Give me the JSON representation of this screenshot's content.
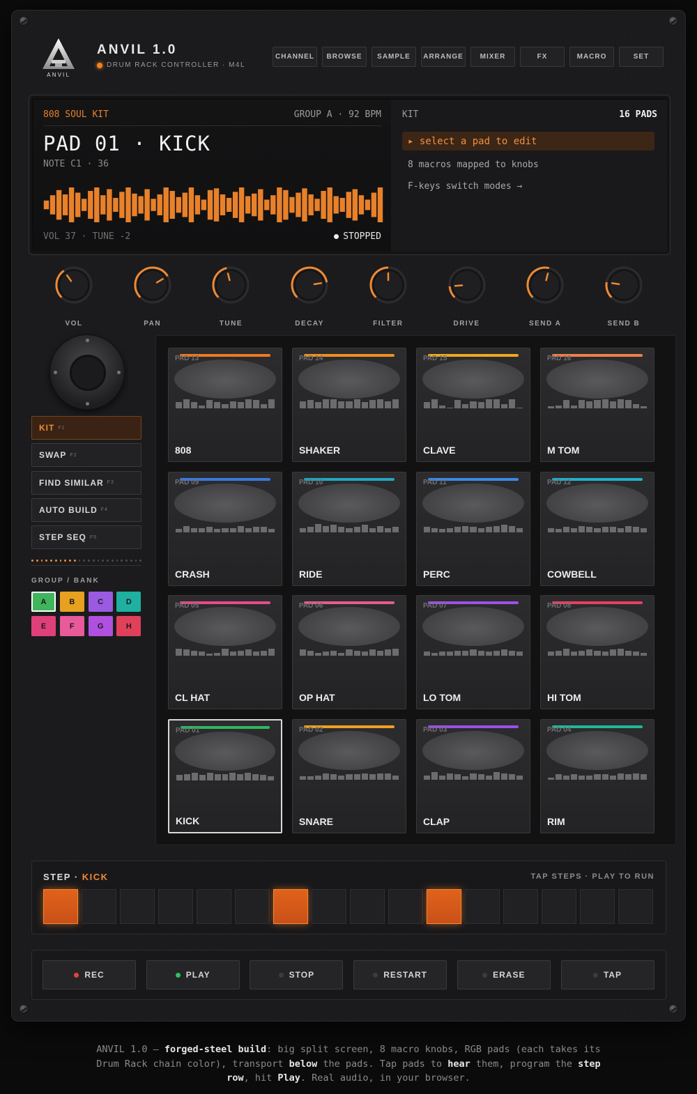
{
  "header": {
    "title": "ANVIL 1.0",
    "subtitle": "DRUM RACK CONTROLLER · M4L",
    "logo_text": "ANVIL",
    "nav": [
      "CHANNEL",
      "BROWSE",
      "SAMPLE",
      "ARRANGE",
      "MIXER",
      "FX",
      "MACRO",
      "SET"
    ]
  },
  "screen": {
    "kit_name": "808 SOUL KIT",
    "group_bpm": "GROUP A · 92 BPM",
    "pad_title": "PAD 01 · KICK",
    "note": "NOTE C1 · 36",
    "vol_tune": "VOL 37 · TUNE -2",
    "status": "STOPPED",
    "kit_label": "KIT",
    "pads_count": "16 PADS",
    "hint_active": "▸ select a pad to edit",
    "hint_1": "8 macros mapped to knobs",
    "hint_2": "F-keys switch modes →",
    "waveform_levels": [
      0.25,
      0.55,
      0.85,
      0.6,
      1.0,
      0.7,
      0.35,
      0.8,
      1.0,
      0.55,
      0.9,
      0.4,
      0.75,
      1.0,
      0.65,
      0.5,
      0.9,
      0.35,
      0.6,
      1.0,
      0.8,
      0.45,
      0.7,
      1.0,
      0.55,
      0.3,
      0.85,
      0.95,
      0.6,
      0.4,
      0.75,
      1.0,
      0.5,
      0.65,
      0.9,
      0.3,
      0.55,
      1.0,
      0.85,
      0.45,
      0.7,
      0.95,
      0.6,
      0.35,
      0.8,
      1.0,
      0.5,
      0.4,
      0.75,
      0.9,
      0.55,
      0.3,
      0.7,
      1.0
    ],
    "accent_color": "#e8812a"
  },
  "knobs": [
    {
      "label": "VOL",
      "value": 0.37
    },
    {
      "label": "PAN",
      "value": 0.72
    },
    {
      "label": "TUNE",
      "value": 0.45
    },
    {
      "label": "DECAY",
      "value": 0.8
    },
    {
      "label": "FILTER",
      "value": 0.5
    },
    {
      "label": "DRIVE",
      "value": 0.15
    },
    {
      "label": "SEND A",
      "value": 0.55
    },
    {
      "label": "SEND B",
      "value": 0.2
    }
  ],
  "modes": [
    {
      "label": "KIT",
      "fkey": "F1",
      "active": true
    },
    {
      "label": "SWAP",
      "fkey": "F2",
      "active": false
    },
    {
      "label": "FIND SIMILAR",
      "fkey": "F3",
      "active": false
    },
    {
      "label": "AUTO BUILD",
      "fkey": "F4",
      "active": false
    },
    {
      "label": "STEP SEQ",
      "fkey": "F5",
      "active": false
    }
  ],
  "group_bank": {
    "label": "GROUP / BANK",
    "groups": [
      {
        "name": "A",
        "color": "#3fb55c",
        "selected": true
      },
      {
        "name": "B",
        "color": "#e8a020",
        "selected": false
      },
      {
        "name": "C",
        "color": "#9a5be0",
        "selected": false
      },
      {
        "name": "D",
        "color": "#1eb0a0",
        "selected": false
      },
      {
        "name": "E",
        "color": "#e0407a",
        "selected": false
      },
      {
        "name": "F",
        "color": "#e85a9a",
        "selected": false
      },
      {
        "name": "G",
        "color": "#b050e0",
        "selected": false
      },
      {
        "name": "H",
        "color": "#e0405a",
        "selected": false
      }
    ]
  },
  "pads": [
    {
      "num": "PAD 13",
      "name": "808",
      "color": "#f07820"
    },
    {
      "num": "PAD 14",
      "name": "SHAKER",
      "color": "#f09020"
    },
    {
      "num": "PAD 15",
      "name": "CLAVE",
      "color": "#f0a820"
    },
    {
      "num": "PAD 16",
      "name": "M TOM",
      "color": "#f0804a"
    },
    {
      "num": "PAD 09",
      "name": "CRASH",
      "color": "#3a78e0"
    },
    {
      "num": "PAD 10",
      "name": "RIDE",
      "color": "#20a8c0"
    },
    {
      "num": "PAD 11",
      "name": "PERC",
      "color": "#3a8ae8"
    },
    {
      "num": "PAD 12",
      "name": "COWBELL",
      "color": "#20b0c8"
    },
    {
      "num": "PAD 05",
      "name": "CL HAT",
      "color": "#e84a8a"
    },
    {
      "num": "PAD 06",
      "name": "OP HAT",
      "color": "#e85a90"
    },
    {
      "num": "PAD 07",
      "name": "LO TOM",
      "color": "#a050e8"
    },
    {
      "num": "PAD 08",
      "name": "HI TOM",
      "color": "#e84060"
    },
    {
      "num": "PAD 01",
      "name": "KICK",
      "color": "#30b860",
      "selected": true
    },
    {
      "num": "PAD 02",
      "name": "SNARE",
      "color": "#f0a020"
    },
    {
      "num": "PAD 03",
      "name": "CLAP",
      "color": "#9a50e8"
    },
    {
      "num": "PAD 04",
      "name": "RIM",
      "color": "#20b89a"
    }
  ],
  "step": {
    "title": "STEP ·",
    "pad": "KICK",
    "hint": "TAP STEPS · PLAY TO RUN",
    "steps": [
      1,
      0,
      0,
      0,
      0,
      0,
      1,
      0,
      0,
      0,
      1,
      0,
      0,
      0,
      0,
      0
    ]
  },
  "transport": [
    {
      "label": "REC",
      "led": "#e84040"
    },
    {
      "label": "PLAY",
      "led": "#30c060"
    },
    {
      "label": "STOP",
      "led": "#3c3c3e"
    },
    {
      "label": "RESTART",
      "led": "#3c3c3e"
    },
    {
      "label": "ERASE",
      "led": "#3c3c3e"
    },
    {
      "label": "TAP",
      "led": "#3c3c3e"
    }
  ],
  "caption": {
    "p1": "ANVIL 1.0 — ",
    "b1": "forged-steel build",
    "p2": ": big split screen, 8 macro knobs, RGB pads (each takes its Drum Rack chain color), transport ",
    "b2": "below",
    "p3": " the pads. Tap pads to ",
    "b3": "hear",
    "p4": " them, program the ",
    "b4": "step row",
    "p5": ", hit ",
    "b5": "Play",
    "p6": ". Real audio, in your browser."
  }
}
